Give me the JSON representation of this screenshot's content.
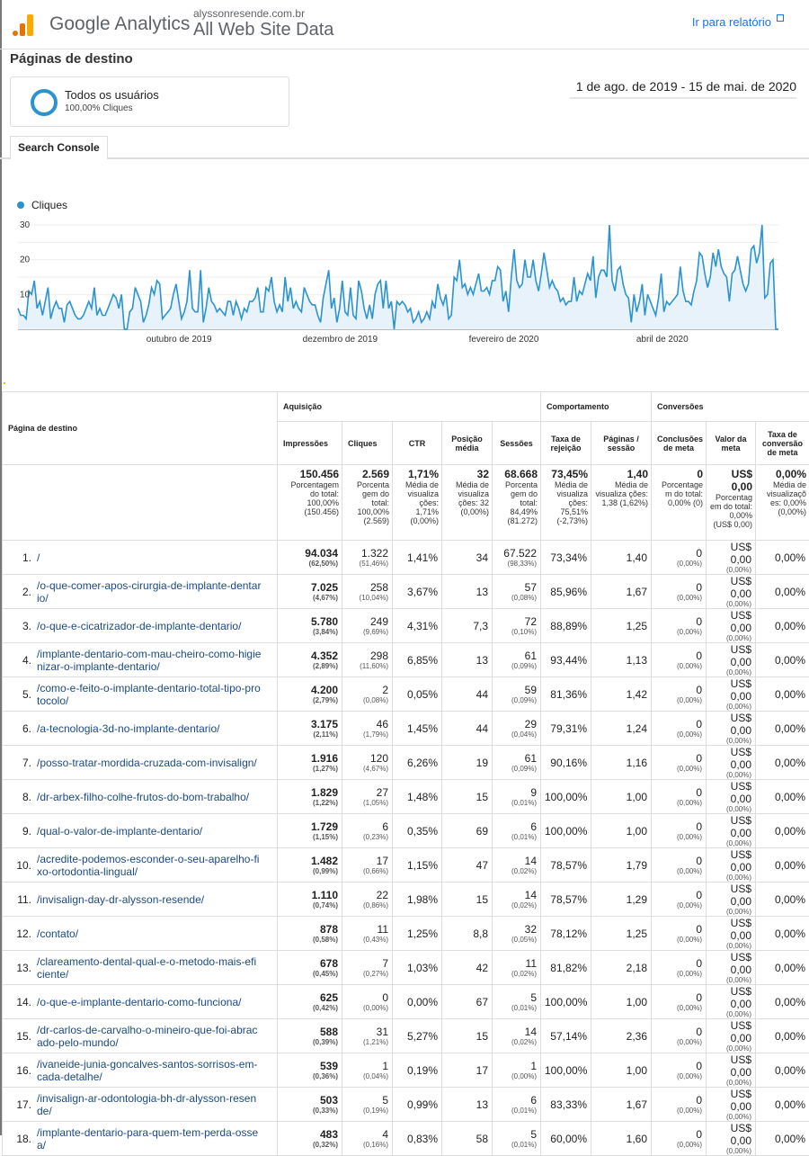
{
  "header": {
    "product": "Google Analytics",
    "site": "alyssonresende.com.br",
    "view": "All Web Site Data",
    "goto_report": "Ir para relatório"
  },
  "page_title": "Páginas de destino",
  "segment": {
    "name": "Todos os usuários",
    "sub": "100,00% Cliques"
  },
  "date_range": "1 de ago. de 2019 - 15 de mai. de 2020",
  "tabs": [
    {
      "label": "Search Console"
    }
  ],
  "chart_data": {
    "type": "area",
    "legend": [
      "Cliques"
    ],
    "y_ticks": [
      "30",
      "20",
      "10"
    ],
    "ylim": [
      0,
      30
    ],
    "x_ticks": [
      "outubro de 2019",
      "dezembro de 2019",
      "fevereiro de 2020",
      "abril de 2020"
    ],
    "series": [
      {
        "name": "Cliques",
        "color": "#2b93cf",
        "values": [
          6,
          4,
          4,
          3,
          11,
          10,
          14,
          6,
          8,
          4,
          8,
          12,
          3,
          6,
          8,
          6,
          6,
          2,
          7,
          8,
          6,
          4,
          3,
          3,
          4,
          6,
          8,
          6,
          12,
          4,
          6,
          4,
          4,
          6,
          8,
          10,
          9,
          6,
          10,
          0,
          0,
          5,
          6,
          12,
          10,
          8,
          2,
          4,
          7,
          12,
          10,
          14,
          13,
          3,
          4,
          5,
          6,
          10,
          13,
          8,
          3,
          5,
          8,
          17,
          6,
          5,
          5,
          17,
          2,
          6,
          12,
          8,
          7,
          5,
          6,
          5,
          4,
          8,
          8,
          4,
          8,
          6,
          3,
          6,
          5,
          8,
          8,
          9,
          12,
          5,
          5,
          12,
          11,
          15,
          8,
          5,
          7,
          5,
          15,
          8,
          12,
          6,
          8,
          6,
          5,
          12,
          10,
          8,
          7,
          7,
          4,
          2,
          9,
          13,
          17,
          6,
          9,
          2,
          6,
          14,
          5,
          4,
          12,
          4,
          3,
          14,
          11,
          6,
          3,
          7,
          3,
          10,
          13,
          14,
          6,
          14,
          6,
          8,
          0,
          8,
          7,
          8,
          7,
          5,
          6,
          2,
          3,
          5,
          2,
          3,
          5,
          3,
          8,
          6,
          13,
          9,
          7,
          10,
          3,
          4,
          15,
          14,
          20,
          12,
          13,
          10,
          12,
          10,
          13,
          16,
          11,
          11,
          12,
          10,
          14,
          14,
          18,
          17,
          8,
          11,
          5,
          15,
          23,
          14,
          12,
          13,
          20,
          15,
          15,
          20,
          14,
          11,
          16,
          22,
          17,
          12,
          14,
          12,
          11,
          8,
          9,
          7,
          8,
          8,
          15,
          8,
          11,
          10,
          13,
          16,
          14,
          21,
          9,
          15,
          17,
          17,
          15,
          30,
          14,
          11,
          17,
          18,
          13,
          10,
          9,
          2,
          10,
          5,
          8,
          13,
          4,
          10,
          8,
          6,
          4,
          9,
          16,
          5,
          8,
          7,
          8,
          9,
          10,
          18,
          11,
          8,
          8,
          7,
          11,
          14,
          22,
          21,
          16,
          12,
          15,
          22,
          18,
          23,
          18,
          16,
          15,
          8,
          16,
          17,
          21,
          17,
          13,
          11,
          13,
          23,
          24,
          19,
          22,
          30,
          9,
          10,
          19,
          20,
          0,
          0
        ]
      }
    ]
  },
  "table": {
    "dimension_header": "Página de destino",
    "groups": [
      {
        "label": "Aquisição"
      },
      {
        "label": "Comportamento"
      },
      {
        "label": "Conversões"
      }
    ],
    "columns": [
      "Impressões",
      "Cliques",
      "CTR",
      "Posição média",
      "Sessões",
      "Taxa de rejeição",
      "Páginas / sessão",
      "Conclusões de meta",
      "Valor da meta",
      "Taxa de conversão de meta"
    ],
    "totals": [
      {
        "value": "150.456",
        "note": "Porcentagem do total: 100,00% (150.456)"
      },
      {
        "value": "2.569",
        "note": "Porcenta gem do total: 100,00% (2.569)"
      },
      {
        "value": "1,71%",
        "note": "Média de visualiza ções: 1,71% (0,00%)"
      },
      {
        "value": "32",
        "note": "Média de visualiza ções: 32 (0,00%)"
      },
      {
        "value": "68.668",
        "note": "Porcenta gem do total: 84,49% (81.272)"
      },
      {
        "value": "73,45%",
        "note": "Média de visualiza ções: 75,51% (-2,73%)"
      },
      {
        "value": "1,40",
        "note": "Média de visualiza ções: 1,38 (1,62%)"
      },
      {
        "value": "0",
        "note": "Porcentage m do total: 0,00% (0)"
      },
      {
        "value": "US$ 0,00",
        "note": "Porcentag em do total: 0,00% (US$ 0,00)"
      },
      {
        "value": "0,00%",
        "note": "Média de visualizaçõ es: 0,00% (0,00%)"
      }
    ],
    "rows": [
      {
        "n": "1.",
        "page": "/",
        "imp": "94.034",
        "imp_pct": "(62,50%)",
        "clk": "1.322",
        "clk_pct": "(51,46%)",
        "ctr": "1,41%",
        "pos": "34",
        "ses": "67.522",
        "ses_pct": "(98,33%)",
        "bounce": "73,34%",
        "pps": "1,40",
        "goal": "0",
        "goal_pct": "(0,00%)",
        "gval": "US$ 0,00",
        "gval_pct": "(0,00%)",
        "conv": "0,00%"
      },
      {
        "n": "2.",
        "page": "/o-que-comer-apos-cirurgia-de-implante-dentario/",
        "imp": "7.025",
        "imp_pct": "(4,67%)",
        "clk": "258",
        "clk_pct": "(10,04%)",
        "ctr": "3,67%",
        "pos": "13",
        "ses": "57",
        "ses_pct": "(0,08%)",
        "bounce": "85,96%",
        "pps": "1,67",
        "goal": "0",
        "goal_pct": "(0,00%)",
        "gval": "US$ 0,00",
        "gval_pct": "(0,00%)",
        "conv": "0,00%"
      },
      {
        "n": "3.",
        "page": "/o-que-e-cicatrizador-de-implante-dentario/",
        "imp": "5.780",
        "imp_pct": "(3,84%)",
        "clk": "249",
        "clk_pct": "(9,69%)",
        "ctr": "4,31%",
        "pos": "7,3",
        "ses": "72",
        "ses_pct": "(0,10%)",
        "bounce": "88,89%",
        "pps": "1,25",
        "goal": "0",
        "goal_pct": "(0,00%)",
        "gval": "US$ 0,00",
        "gval_pct": "(0,00%)",
        "conv": "0,00%"
      },
      {
        "n": "4.",
        "page": "/implante-dentario-com-mau-cheiro-como-higienizar-o-implante-dentario/",
        "imp": "4.352",
        "imp_pct": "(2,89%)",
        "clk": "298",
        "clk_pct": "(11,60%)",
        "ctr": "6,85%",
        "pos": "13",
        "ses": "61",
        "ses_pct": "(0,09%)",
        "bounce": "93,44%",
        "pps": "1,13",
        "goal": "0",
        "goal_pct": "(0,00%)",
        "gval": "US$ 0,00",
        "gval_pct": "(0,00%)",
        "conv": "0,00%"
      },
      {
        "n": "5.",
        "page": "/como-e-feito-o-implante-dentario-total-tipo-protocolo/",
        "imp": "4.200",
        "imp_pct": "(2,79%)",
        "clk": "2",
        "clk_pct": "(0,08%)",
        "ctr": "0,05%",
        "pos": "44",
        "ses": "59",
        "ses_pct": "(0,09%)",
        "bounce": "81,36%",
        "pps": "1,42",
        "goal": "0",
        "goal_pct": "(0,00%)",
        "gval": "US$ 0,00",
        "gval_pct": "(0,00%)",
        "conv": "0,00%"
      },
      {
        "n": "6.",
        "page": "/a-tecnologia-3d-no-implante-dentario/",
        "imp": "3.175",
        "imp_pct": "(2,11%)",
        "clk": "46",
        "clk_pct": "(1,79%)",
        "ctr": "1,45%",
        "pos": "44",
        "ses": "29",
        "ses_pct": "(0,04%)",
        "bounce": "79,31%",
        "pps": "1,24",
        "goal": "0",
        "goal_pct": "(0,00%)",
        "gval": "US$ 0,00",
        "gval_pct": "(0,00%)",
        "conv": "0,00%"
      },
      {
        "n": "7.",
        "page": "/posso-tratar-mordida-cruzada-com-invisalign/",
        "imp": "1.916",
        "imp_pct": "(1,27%)",
        "clk": "120",
        "clk_pct": "(4,67%)",
        "ctr": "6,26%",
        "pos": "19",
        "ses": "61",
        "ses_pct": "(0,09%)",
        "bounce": "90,16%",
        "pps": "1,16",
        "goal": "0",
        "goal_pct": "(0,00%)",
        "gval": "US$ 0,00",
        "gval_pct": "(0,00%)",
        "conv": "0,00%"
      },
      {
        "n": "8.",
        "page": "/dr-arbex-filho-colhe-frutos-do-bom-trabalho/",
        "imp": "1.829",
        "imp_pct": "(1,22%)",
        "clk": "27",
        "clk_pct": "(1,05%)",
        "ctr": "1,48%",
        "pos": "15",
        "ses": "9",
        "ses_pct": "(0,01%)",
        "bounce": "100,00%",
        "pps": "1,00",
        "goal": "0",
        "goal_pct": "(0,00%)",
        "gval": "US$ 0,00",
        "gval_pct": "(0,00%)",
        "conv": "0,00%"
      },
      {
        "n": "9.",
        "page": "/qual-o-valor-de-implante-dentario/",
        "imp": "1.729",
        "imp_pct": "(1,15%)",
        "clk": "6",
        "clk_pct": "(0,23%)",
        "ctr": "0,35%",
        "pos": "69",
        "ses": "6",
        "ses_pct": "(0,01%)",
        "bounce": "100,00%",
        "pps": "1,00",
        "goal": "0",
        "goal_pct": "(0,00%)",
        "gval": "US$ 0,00",
        "gval_pct": "(0,00%)",
        "conv": "0,00%"
      },
      {
        "n": "10.",
        "page": "/acredite-podemos-esconder-o-seu-aparelho-fixo-ortodontia-lingual/",
        "imp": "1.482",
        "imp_pct": "(0,99%)",
        "clk": "17",
        "clk_pct": "(0,66%)",
        "ctr": "1,15%",
        "pos": "47",
        "ses": "14",
        "ses_pct": "(0,02%)",
        "bounce": "78,57%",
        "pps": "1,79",
        "goal": "0",
        "goal_pct": "(0,00%)",
        "gval": "US$ 0,00",
        "gval_pct": "(0,00%)",
        "conv": "0,00%"
      },
      {
        "n": "11.",
        "page": "/invisalign-day-dr-alysson-resende/",
        "imp": "1.110",
        "imp_pct": "(0,74%)",
        "clk": "22",
        "clk_pct": "(0,86%)",
        "ctr": "1,98%",
        "pos": "15",
        "ses": "14",
        "ses_pct": "(0,02%)",
        "bounce": "78,57%",
        "pps": "1,29",
        "goal": "0",
        "goal_pct": "(0,00%)",
        "gval": "US$ 0,00",
        "gval_pct": "(0,00%)",
        "conv": "0,00%"
      },
      {
        "n": "12.",
        "page": "/contato/",
        "imp": "878",
        "imp_pct": "(0,58%)",
        "clk": "11",
        "clk_pct": "(0,43%)",
        "ctr": "1,25%",
        "pos": "8,8",
        "ses": "32",
        "ses_pct": "(0,05%)",
        "bounce": "78,12%",
        "pps": "1,25",
        "goal": "0",
        "goal_pct": "(0,00%)",
        "gval": "US$ 0,00",
        "gval_pct": "(0,00%)",
        "conv": "0,00%"
      },
      {
        "n": "13.",
        "page": "/clareamento-dental-qual-e-o-metodo-mais-eficiente/",
        "imp": "678",
        "imp_pct": "(0,45%)",
        "clk": "7",
        "clk_pct": "(0,27%)",
        "ctr": "1,03%",
        "pos": "42",
        "ses": "11",
        "ses_pct": "(0,02%)",
        "bounce": "81,82%",
        "pps": "2,18",
        "goal": "0",
        "goal_pct": "(0,00%)",
        "gval": "US$ 0,00",
        "gval_pct": "(0,00%)",
        "conv": "0,00%"
      },
      {
        "n": "14.",
        "page": "/o-que-e-implante-dentario-como-funciona/",
        "imp": "625",
        "imp_pct": "(0,42%)",
        "clk": "0",
        "clk_pct": "(0,00%)",
        "ctr": "0,00%",
        "pos": "67",
        "ses": "5",
        "ses_pct": "(0,01%)",
        "bounce": "100,00%",
        "pps": "1,00",
        "goal": "0",
        "goal_pct": "(0,00%)",
        "gval": "US$ 0,00",
        "gval_pct": "(0,00%)",
        "conv": "0,00%"
      },
      {
        "n": "15.",
        "page": "/dr-carlos-de-carvalho-o-mineiro-que-foi-abracado-pelo-mundo/",
        "imp": "588",
        "imp_pct": "(0,39%)",
        "clk": "31",
        "clk_pct": "(1,21%)",
        "ctr": "5,27%",
        "pos": "15",
        "ses": "14",
        "ses_pct": "(0,02%)",
        "bounce": "57,14%",
        "pps": "2,36",
        "goal": "0",
        "goal_pct": "(0,00%)",
        "gval": "US$ 0,00",
        "gval_pct": "(0,00%)",
        "conv": "0,00%"
      },
      {
        "n": "16.",
        "page": "/ivaneide-junia-goncalves-santos-sorrisos-em-cada-detalhe/",
        "imp": "539",
        "imp_pct": "(0,36%)",
        "clk": "1",
        "clk_pct": "(0,04%)",
        "ctr": "0,19%",
        "pos": "17",
        "ses": "1",
        "ses_pct": "(0,00%)",
        "bounce": "100,00%",
        "pps": "1,00",
        "goal": "0",
        "goal_pct": "(0,00%)",
        "gval": "US$ 0,00",
        "gval_pct": "(0,00%)",
        "conv": "0,00%"
      },
      {
        "n": "17.",
        "page": "/invisalign-ar-odontologia-bh-dr-alysson-resende/",
        "imp": "503",
        "imp_pct": "(0,33%)",
        "clk": "5",
        "clk_pct": "(0,19%)",
        "ctr": "0,99%",
        "pos": "13",
        "ses": "6",
        "ses_pct": "(0,01%)",
        "bounce": "83,33%",
        "pps": "1,67",
        "goal": "0",
        "goal_pct": "(0,00%)",
        "gval": "US$ 0,00",
        "gval_pct": "(0,00%)",
        "conv": "0,00%"
      },
      {
        "n": "18.",
        "page": "/implante-dentario-para-quem-tem-perda-ossea/",
        "imp": "483",
        "imp_pct": "(0,32%)",
        "clk": "4",
        "clk_pct": "(0,16%)",
        "ctr": "0,83%",
        "pos": "58",
        "ses": "5",
        "ses_pct": "(0,01%)",
        "bounce": "60,00%",
        "pps": "1,60",
        "goal": "0",
        "goal_pct": "(0,00%)",
        "gval": "US$ 0,00",
        "gval_pct": "(0,00%)",
        "conv": "0,00%"
      }
    ]
  }
}
